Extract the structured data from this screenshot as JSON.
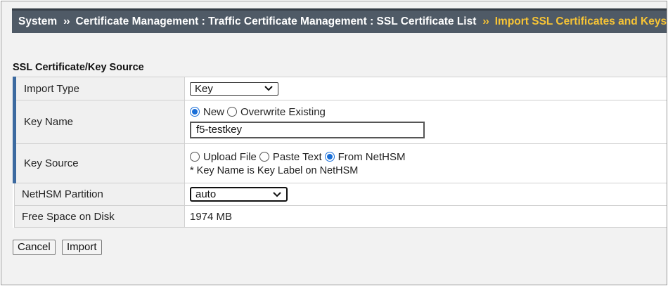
{
  "breadcrumb": {
    "items": [
      "System",
      "Certificate Management : Traffic Certificate Management : SSL Certificate List",
      "Import SSL Certificates and Keys"
    ],
    "separator": "››"
  },
  "section": {
    "title": "SSL Certificate/Key Source"
  },
  "rows": {
    "import_type": {
      "label": "Import Type",
      "selected": "Key"
    },
    "key_name": {
      "label": "Key Name",
      "options": [
        "New",
        "Overwrite Existing"
      ],
      "selected": "New",
      "value": "f5-testkey"
    },
    "key_source": {
      "label": "Key Source",
      "options": [
        "Upload File",
        "Paste Text",
        "From NetHSM"
      ],
      "selected": "From NetHSM",
      "note": "* Key Name is Key Label on NetHSM"
    },
    "nethsm_partition": {
      "label": "NetHSM Partition",
      "selected": "auto"
    },
    "free_space": {
      "label": "Free Space on Disk",
      "value": "1974 MB"
    }
  },
  "buttons": {
    "cancel": "Cancel",
    "import": "Import"
  },
  "colors": {
    "header_bg": "#4f5a66",
    "active_crumb": "#f7c435",
    "required_marker": "#3c6aa0",
    "radio_selected": "#1a6fd8"
  }
}
